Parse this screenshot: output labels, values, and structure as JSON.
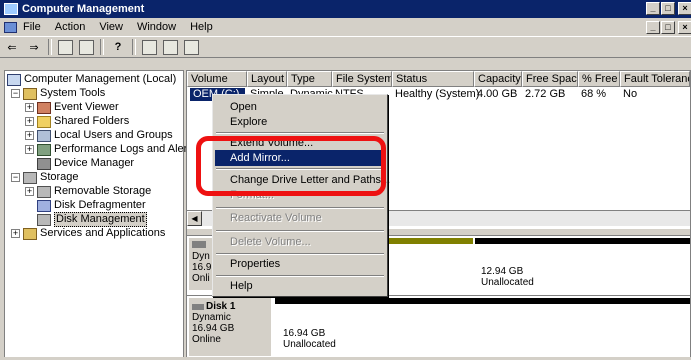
{
  "window": {
    "title": "Computer Management",
    "controls": [
      "_",
      "□",
      "×"
    ]
  },
  "menubar": {
    "items": [
      "File",
      "Action",
      "View",
      "Window",
      "Help"
    ],
    "mdi_controls": [
      "_",
      "□",
      "×"
    ]
  },
  "tree": {
    "root": "Computer Management (Local)",
    "system_tools": "System Tools",
    "event_viewer": "Event Viewer",
    "shared_folders": "Shared Folders",
    "local_users": "Local Users and Groups",
    "perf_logs": "Performance Logs and Alerts",
    "device_manager": "Device Manager",
    "storage": "Storage",
    "removable_storage": "Removable Storage",
    "disk_defrag": "Disk Defragmenter",
    "disk_management": "Disk Management",
    "services": "Services and Applications"
  },
  "volumes": {
    "headers": [
      "Volume",
      "Layout",
      "Type",
      "File System",
      "Status",
      "Capacity",
      "Free Space",
      "% Free",
      "Fault Tolerance"
    ],
    "row": [
      "OEM (C:)",
      "Simple",
      "Dynamic",
      "NTFS",
      "Healthy (System)",
      "4.00 GB",
      "2.72 GB",
      "68 %",
      "No"
    ]
  },
  "disk0": {
    "type": "Dyn",
    "size": "16.9",
    "status": "Onli",
    "unalloc_size": "12.94 GB",
    "unalloc_label": "Unallocated"
  },
  "disk1": {
    "name": "Disk 1",
    "type": "Dynamic",
    "size": "16.94 GB",
    "status": "Online",
    "part_size": "16.94 GB",
    "part_label": "Unallocated"
  },
  "context_menu": {
    "open": "Open",
    "explore": "Explore",
    "extend": "Extend Volume...",
    "add_mirror": "Add Mirror...",
    "change_letter": "Change Drive Letter and Paths...",
    "format": "Format...",
    "reactivate": "Reactivate Volume",
    "delete": "Delete Volume...",
    "properties": "Properties",
    "help": "Help"
  },
  "colors": {
    "title_bar": "#0a246a",
    "highlight": "#0a246a",
    "callout": "#ee1111",
    "primary_partition": "#808000",
    "unallocated_bar": "#000000"
  }
}
